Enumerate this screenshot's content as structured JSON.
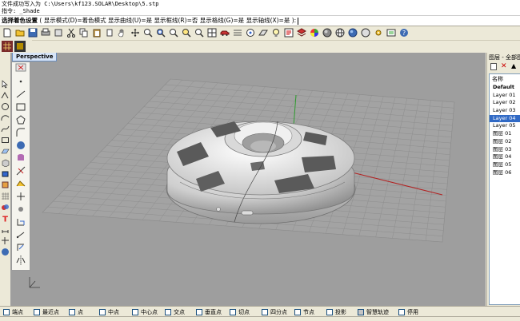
{
  "command_history": {
    "line1": "文件成功写入为 C:\\Users\\kf123.SOLAR\\Desktop\\5.stp",
    "line2": "指令: _Shade"
  },
  "command_prompt": {
    "label": "选择着色设置",
    "options": "( 显示模式(D)=着色模式  显示曲线(U)=是  显示框线(R)=否  显示格线(G)=是  显示轴线(X)=是 ):"
  },
  "viewport": {
    "title": "Perspective"
  },
  "layers_panel": {
    "title": "图层 - 全部图",
    "column_header": "名称",
    "layers": [
      "Default",
      "Layer 01",
      "Layer 02",
      "Layer 03",
      "Layer 04",
      "Layer 05",
      "图层 01",
      "图层 02",
      "图层 03",
      "图层 04",
      "图层 05",
      "图层 06"
    ],
    "selected": "Layer 04"
  },
  "osnap": {
    "items": [
      {
        "label": "端点",
        "checked": false
      },
      {
        "label": "最近点",
        "checked": false
      },
      {
        "label": "点",
        "checked": false
      },
      {
        "label": "中点",
        "checked": false
      },
      {
        "label": "中心点",
        "checked": false
      },
      {
        "label": "交点",
        "checked": false
      },
      {
        "label": "垂直点",
        "checked": false
      },
      {
        "label": "切点",
        "checked": false
      },
      {
        "label": "四分点",
        "checked": false
      },
      {
        "label": "节点",
        "checked": false
      },
      {
        "label": "投影",
        "checked": false
      },
      {
        "label": "智慧轨迹",
        "checked": true
      },
      {
        "label": "停用",
        "checked": false
      }
    ]
  },
  "colors": {
    "viewport_bg": "#9e9e9e",
    "grid": "#8e8e8e",
    "x_axis": "#b22222",
    "y_axis": "#2e9b2e",
    "selection": "#316ac5"
  }
}
